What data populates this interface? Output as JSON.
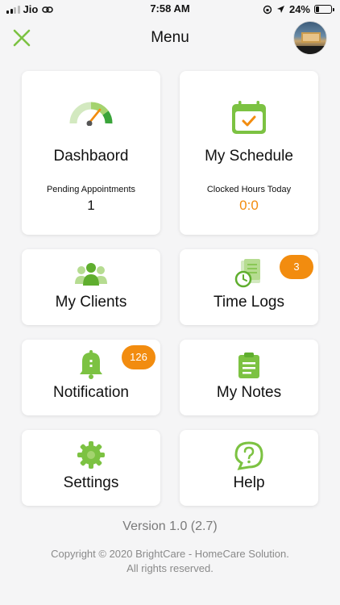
{
  "status_bar": {
    "carrier": "Jio",
    "time": "7:58 AM",
    "battery": "24%"
  },
  "header": {
    "title": "Menu"
  },
  "colors": {
    "accent_green": "#7cc242",
    "badge_orange": "#f28c0f",
    "value_orange": "#f28c0f"
  },
  "cards": {
    "dashboard": {
      "title": "Dashbaord",
      "sub": "Pending Appointments",
      "value": "1",
      "icon": "gauge-icon"
    },
    "schedule": {
      "title": "My Schedule",
      "sub": "Clocked Hours Today",
      "value": "0:0",
      "icon": "calendar-check-icon"
    },
    "clients": {
      "title": "My Clients",
      "icon": "group-users-icon"
    },
    "timelogs": {
      "title": "Time Logs",
      "badge": "3",
      "icon": "timesheet-clock-icon"
    },
    "notification": {
      "title": "Notification",
      "badge": "126",
      "icon": "bell-icon"
    },
    "notes": {
      "title": "My Notes",
      "icon": "clipboard-icon"
    },
    "settings": {
      "title": "Settings",
      "icon": "gear-icon"
    },
    "help": {
      "title": "Help",
      "icon": "question-bubble-icon"
    }
  },
  "footer": {
    "version": "Version 1.0 (2.7)",
    "copyright": "Copyright © 2020 BrightCare - HomeCare Solution. All rights reserved."
  }
}
